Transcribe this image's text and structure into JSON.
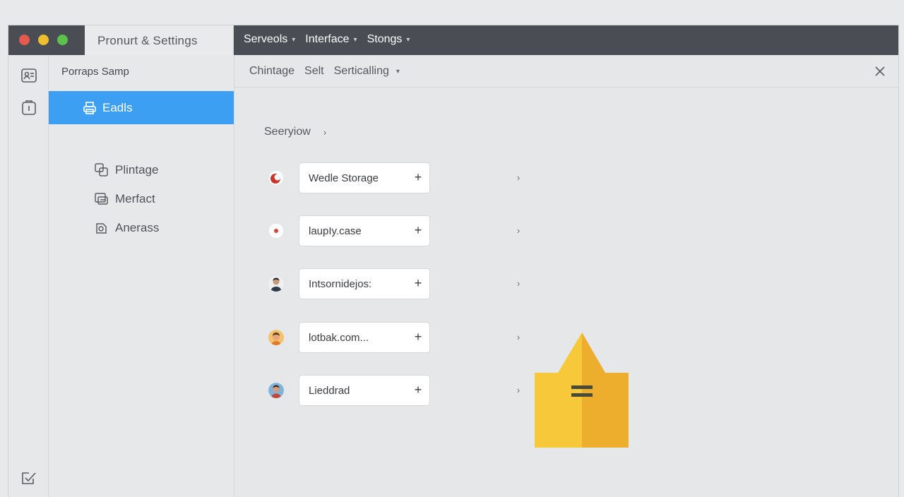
{
  "window": {
    "title": "Pronurt & Settings",
    "controls": [
      "close",
      "minimize",
      "maximize"
    ]
  },
  "top_menu": {
    "items": [
      {
        "label": "Serveols",
        "has_dropdown": true
      },
      {
        "label": "Interface",
        "has_dropdown": true
      },
      {
        "label": "Stongs",
        "has_dropdown": true
      }
    ]
  },
  "rail": {
    "icons": [
      "profile-card-icon",
      "document-icon",
      "edit-check-icon"
    ]
  },
  "sidebar": {
    "heading": "Porraps Samp",
    "active_item": {
      "label": "Eadls",
      "icon": "printer-icon"
    },
    "items": [
      {
        "label": "Plintage",
        "icon": "copy-icon"
      },
      {
        "label": "Merfact",
        "icon": "card-icon"
      },
      {
        "label": "Anerass",
        "icon": "palette-icon"
      }
    ]
  },
  "subbar": {
    "tabs": [
      "Chintage",
      "Selt",
      "Serticalling"
    ],
    "close_icon": "close-icon"
  },
  "main": {
    "breadcrumb": "Seeryiow",
    "rows": [
      {
        "label": "Wedle Storage",
        "avatar": "red-logo"
      },
      {
        "label": "laupIy.case",
        "avatar": "small-logo"
      },
      {
        "label": "Intsornidejos:",
        "avatar": "person-dark"
      },
      {
        "label": "lotbak.com...",
        "avatar": "person-orange"
      },
      {
        "label": "Lieddrad",
        "avatar": "person-blue"
      }
    ]
  },
  "colors": {
    "accent": "#3d9ff2",
    "titlebar": "#4a4e54",
    "crown_light": "#f7c93a",
    "crown_dark": "#edae2d"
  }
}
